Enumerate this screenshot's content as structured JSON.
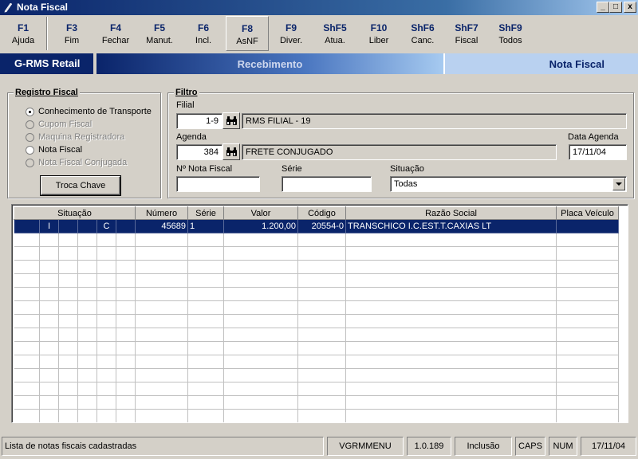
{
  "window": {
    "title": "Nota Fiscal",
    "minimize": "_",
    "maximize": "□",
    "close": "x"
  },
  "fkeys": [
    {
      "key": "F1",
      "label": "Ajuda"
    },
    {
      "key": "F3",
      "label": "Fim"
    },
    {
      "key": "F4",
      "label": "Fechar"
    },
    {
      "key": "F5",
      "label": "Manut."
    },
    {
      "key": "F6",
      "label": "Incl."
    },
    {
      "key": "F8",
      "label": "AsNF"
    },
    {
      "key": "F9",
      "label": "Diver."
    },
    {
      "key": "ShF5",
      "label": "Atua."
    },
    {
      "key": "F10",
      "label": "Liber"
    },
    {
      "key": "ShF6",
      "label": "Canc."
    },
    {
      "key": "ShF7",
      "label": "Fiscal"
    },
    {
      "key": "ShF9",
      "label": "Todos"
    }
  ],
  "banner": {
    "app": "G-RMS Retail",
    "module": "Recebimento",
    "screen": "Nota Fiscal"
  },
  "registro": {
    "title": "Registro Fiscal",
    "options": [
      {
        "label": "Conhecimento de Transporte",
        "selected": true,
        "enabled": true
      },
      {
        "label": "Cupom Fiscal",
        "selected": false,
        "enabled": false
      },
      {
        "label": "Maquina Registradora",
        "selected": false,
        "enabled": false
      },
      {
        "label": "Nota Fiscal",
        "selected": false,
        "enabled": true
      },
      {
        "label": "Nota Fiscal Conjugada",
        "selected": false,
        "enabled": false
      }
    ],
    "button": "Troca Chave"
  },
  "filtro": {
    "title": "Filtro",
    "filial_label": "Filial",
    "filial_code": "1-9",
    "filial_name": "RMS FILIAL - 19",
    "agenda_label": "Agenda",
    "agenda_code": "384",
    "agenda_name": "FRETE CONJUGADO",
    "data_agenda_label": "Data Agenda",
    "data_agenda": "17/11/04",
    "nota_label": "Nº Nota Fiscal",
    "nota_value": "",
    "serie_label": "Série",
    "serie_value": "",
    "situacao_label": "Situação",
    "situacao_value": "Todas"
  },
  "grid": {
    "headers": {
      "situacao": "Situação",
      "numero": "Número",
      "serie": "Série",
      "valor": "Valor",
      "codigo": "Código",
      "razao": "Razão Social",
      "placa": "Placa Veículo"
    },
    "rows": [
      {
        "s1": "",
        "s2": "I",
        "s3": "",
        "s4": "",
        "s5": "C",
        "s6": "",
        "numero": "45689",
        "serie": "1",
        "valor": "1.200,00",
        "codigo": "20554-0",
        "razao": "TRANSCHICO I.C.EST.T.CAXIAS LT",
        "placa": ""
      }
    ]
  },
  "status": {
    "message": "Lista de notas fiscais cadastradas",
    "menu": "VGRMMENU",
    "version": "1.0.189",
    "mode": "Inclusão",
    "caps": "CAPS",
    "num": "NUM",
    "date": "17/11/04"
  }
}
